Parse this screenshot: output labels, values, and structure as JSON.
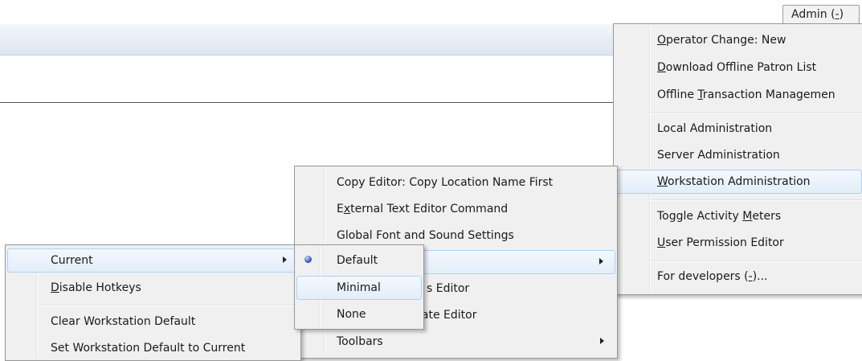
{
  "admin_button": {
    "label": "Admin (",
    "mnemonic": "-",
    "suffix": ")"
  },
  "admin_menu": {
    "items": [
      {
        "mnemonic": "O",
        "rest": "perator Change: New"
      },
      {
        "mnemonic": "D",
        "rest": "ownload Offline Patron List"
      },
      {
        "pre": "Offline ",
        "mnemonic": "T",
        "rest": "ransaction Managemen"
      },
      {
        "text": "Local Administration"
      },
      {
        "text": "Server Administration"
      },
      {
        "mnemonic": "W",
        "rest": "orkstation Administration"
      },
      {
        "pre": "Toggle Activity ",
        "mnemonic": "M",
        "rest": "eters"
      },
      {
        "mnemonic": "U",
        "rest": "ser Permission Editor"
      },
      {
        "pre": "For developers (",
        "mnemonic": "-",
        "rest": ")..."
      }
    ]
  },
  "workstation_menu": {
    "items": [
      {
        "text": "Copy Editor: Copy Location Name First"
      },
      {
        "pre": "E",
        "mnemonic": "x",
        "rest": "ternal Text Editor Command"
      },
      {
        "text": "Global Font and Sound Settings"
      },
      {
        "text": ""
      },
      {
        "text": "s Editor"
      },
      {
        "text": "late Editor"
      },
      {
        "text": "Toolbars"
      }
    ]
  },
  "toolbar_menu": {
    "items": [
      {
        "text": "Current"
      },
      {
        "mnemonic": "D",
        "rest": "isable Hotkeys"
      },
      {
        "text": "Clear Workstation Default"
      },
      {
        "text": "Set Workstation Default to Current"
      }
    ]
  },
  "current_menu": {
    "items": [
      {
        "text": "Default",
        "selected": true
      },
      {
        "text": "Minimal"
      },
      {
        "text": "None"
      }
    ]
  }
}
